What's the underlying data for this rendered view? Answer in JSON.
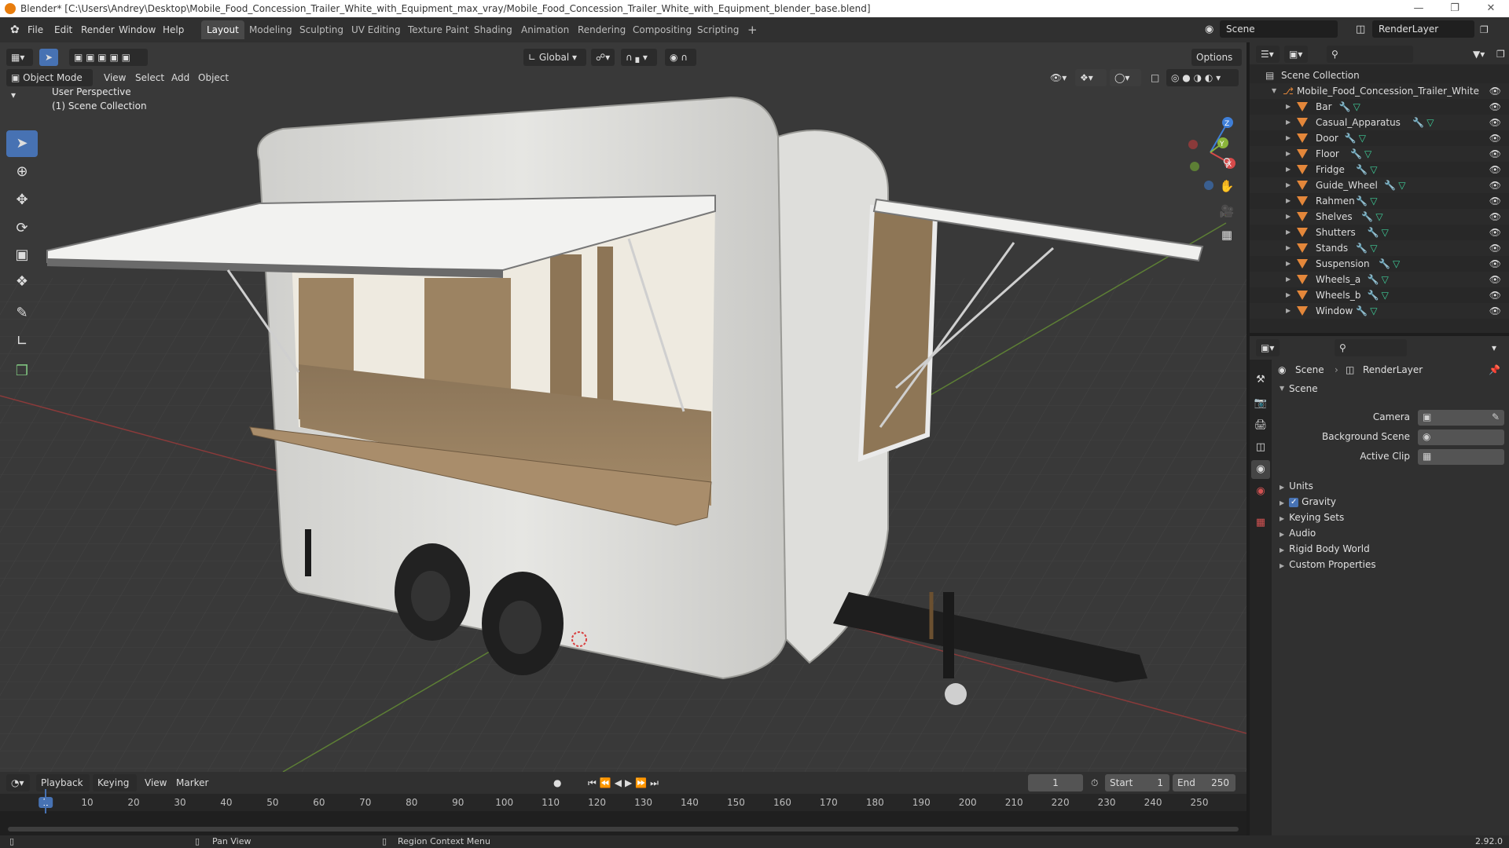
{
  "window": {
    "title": "Blender* [C:\\Users\\Andrey\\Desktop\\Mobile_Food_Concession_Trailer_White_with_Equipment_max_vray/Mobile_Food_Concession_Trailer_White_with_Equipment_blender_base.blend]"
  },
  "menu": {
    "items": [
      "File",
      "Edit",
      "Render",
      "Window",
      "Help"
    ]
  },
  "workspaces": [
    "Layout",
    "Modeling",
    "Sculpting",
    "UV Editing",
    "Texture Paint",
    "Shading",
    "Animation",
    "Rendering",
    "Compositing",
    "Scripting"
  ],
  "active_workspace": "Layout",
  "scene_selector": {
    "scene": "Scene",
    "view_layer": "RenderLayer"
  },
  "viewport": {
    "mode": "Object Mode",
    "menus": [
      "View",
      "Select",
      "Add",
      "Object"
    ],
    "orientation": "Global",
    "options_label": "Options",
    "overlay_line1": "User Perspective",
    "overlay_line2": "(1) Scene Collection",
    "gizmo": {
      "x": "X",
      "y": "Y",
      "z": "Z"
    }
  },
  "outliner": {
    "root": "Scene Collection",
    "collection": "Mobile_Food_Concession_Trailer_White_with",
    "objects": [
      "Bar",
      "Casual_Apparatus",
      "Door",
      "Floor",
      "Fridge",
      "Guide_Wheel",
      "Rahmen",
      "Shelves",
      "Shutters",
      "Stands",
      "Suspension",
      "Wheels_a",
      "Wheels_b",
      "Window"
    ]
  },
  "properties": {
    "breadcrumb_scene": "Scene",
    "breadcrumb_layer": "RenderLayer",
    "panel_title": "Scene",
    "camera_label": "Camera",
    "background_label": "Background Scene",
    "active_clip_label": "Active Clip",
    "sections": [
      "Units",
      "Gravity",
      "Keying Sets",
      "Audio",
      "Rigid Body World",
      "Custom Properties"
    ],
    "gravity_checked": true
  },
  "timeline": {
    "menus": [
      "Playback",
      "Keying",
      "View",
      "Marker"
    ],
    "current_frame": "1",
    "start_label": "Start",
    "start_value": "1",
    "end_label": "End",
    "end_value": "250",
    "ticks": [
      "1",
      "10",
      "20",
      "30",
      "40",
      "50",
      "60",
      "70",
      "80",
      "90",
      "100",
      "110",
      "120",
      "130",
      "140",
      "150",
      "160",
      "170",
      "180",
      "190",
      "200",
      "210",
      "220",
      "230",
      "240",
      "250"
    ]
  },
  "statusbar": {
    "pan": "Pan View",
    "context": "Region Context Menu",
    "version": "2.92.0"
  }
}
